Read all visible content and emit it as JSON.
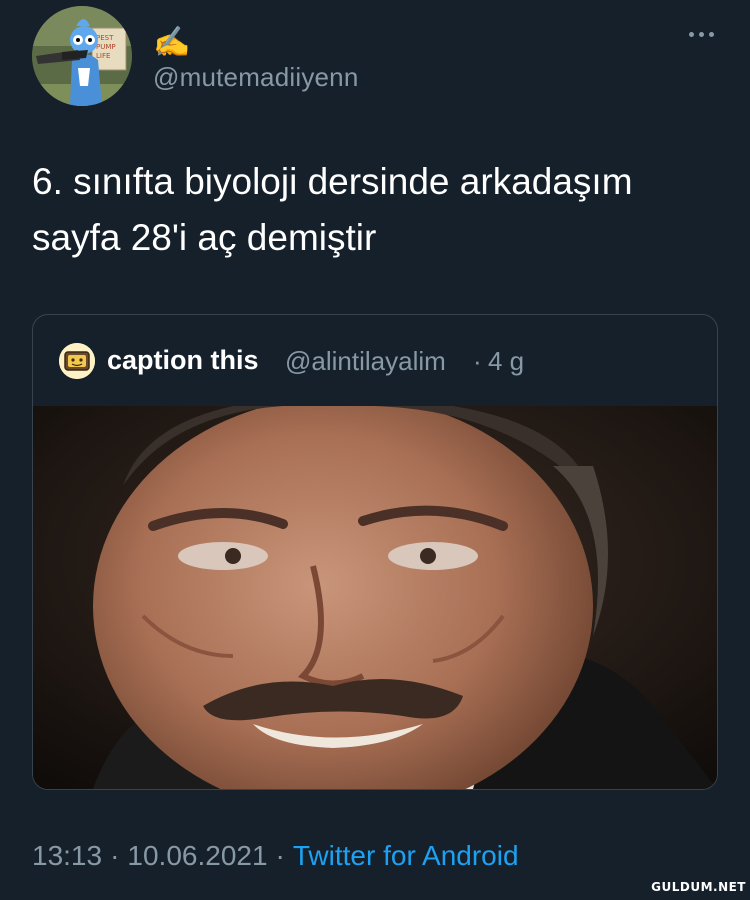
{
  "tweet": {
    "display_name": "✍️",
    "handle": "@mutemadiiyenn",
    "text_lines": [
      "6. sınıfta biyoloji dersinde arkadaşım",
      "sayfa 28'i aç demiştir"
    ],
    "more_icon": "more-horizontal-icon"
  },
  "quoted_tweet": {
    "name": "caption this",
    "handle": "@alintilayalim",
    "separator": "·",
    "time": "4 g",
    "image_description_icon": "photo"
  },
  "footer": {
    "time": "13:13",
    "separator": "·",
    "date": "10.06.2021",
    "source": "Twitter for Android"
  },
  "watermark": "GULDUM.NET",
  "colors": {
    "background": "#15202b",
    "secondary_text": "#8899a6",
    "link": "#1da1f2",
    "border": "#38444d"
  }
}
